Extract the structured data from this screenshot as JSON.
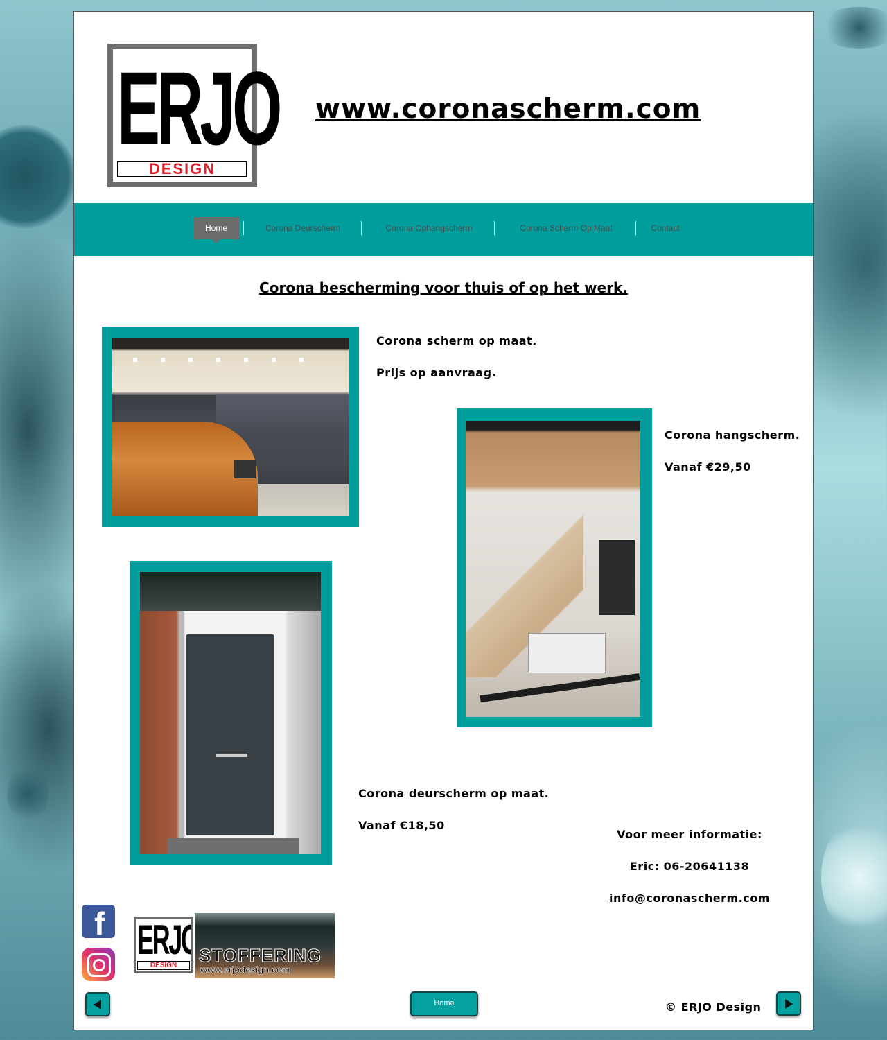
{
  "header": {
    "logo_main": "ERJO",
    "logo_sub": "DESIGN",
    "site_url": "www.coronascherm.com"
  },
  "nav": {
    "items": [
      {
        "label": "Home",
        "active": true
      },
      {
        "label": "Corona Deurscherm",
        "active": false
      },
      {
        "label": "Corona Ophangscherm",
        "active": false
      },
      {
        "label": "Corona Scherm Op Maat",
        "active": false
      },
      {
        "label": "Contact",
        "active": false
      }
    ]
  },
  "main": {
    "heading": "Corona bescherming voor thuis of op het werk.",
    "products": [
      {
        "title": "Corona scherm op maat.",
        "price": "Prijs op aanvraag."
      },
      {
        "title": "Corona hangscherm.",
        "price": "Vanaf €29,50"
      },
      {
        "title": "Corona deurscherm op maat.",
        "price": "Vanaf €18,50"
      }
    ],
    "contact": {
      "heading": "Voor meer informatie:",
      "phone": "Eric: 06-20641138",
      "email": "info@coronascherm.com"
    }
  },
  "banner": {
    "logo_main": "ERJO",
    "logo_sub": "DESIGN",
    "title": "STOFFERING",
    "url": "www.erjodesign.com"
  },
  "social": {
    "facebook_glyph": "f"
  },
  "footer": {
    "home_button": "Home",
    "copyright": "© ERJO Design"
  },
  "colors": {
    "accent": "#029e9e",
    "nav_active": "#6b6b6b",
    "logo_red": "#e0222b"
  }
}
